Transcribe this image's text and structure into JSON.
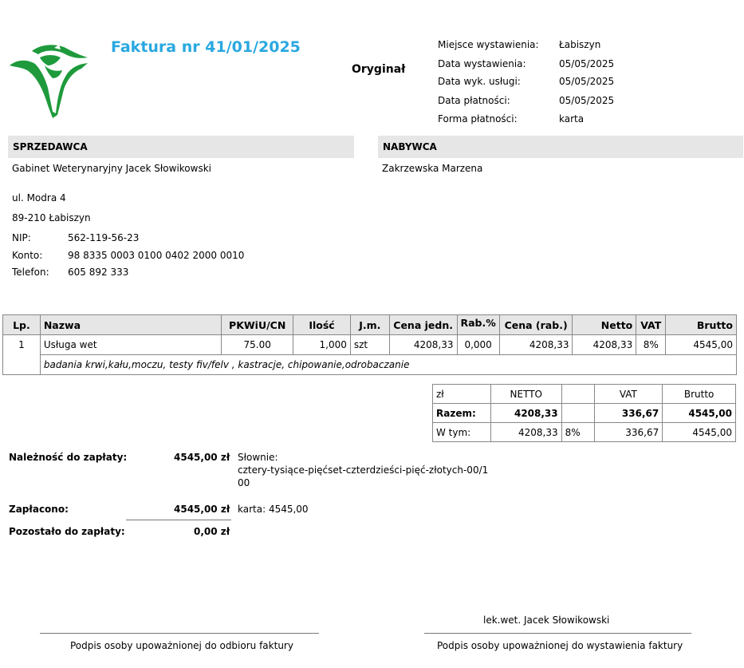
{
  "header": {
    "title": "Faktura nr 41/01/2025",
    "original": "Oryginał",
    "meta": [
      {
        "label": "Miejsce wystawienia:",
        "value": "Łabiszyn"
      },
      {
        "label": "Data wystawienia:",
        "value": "05/05/2025"
      },
      {
        "label": "Data wyk. usługi:",
        "value": "05/05/2025"
      },
      {
        "label": "Data płatności:",
        "value": "05/05/2025"
      },
      {
        "label": "Forma płatności:",
        "value": "karta"
      }
    ]
  },
  "seller": {
    "heading": "SPRZEDAWCA",
    "name": "Gabinet Weterynaryjny Jacek Słowikowski",
    "street": "ul. Modra 4",
    "city": "89-210 Łabiszyn",
    "nip_label": "NIP:",
    "nip": "562-119-56-23",
    "konto_label": "Konto:",
    "konto": "98 8335 0003 0100 0402 2000 0010",
    "tel_label": "Telefon:",
    "tel": "605 892 333"
  },
  "buyer": {
    "heading": "NABYWCA",
    "name": "Zakrzewska Marzena"
  },
  "items": {
    "headers": {
      "lp": "Lp.",
      "nazwa": "Nazwa",
      "pkwiu": "PKWiU/CN",
      "ilosc": "Ilość",
      "jm": "J.m.",
      "cena": "Cena jedn.",
      "rab": "Rab.%",
      "cena_rab": "Cena (rab.)",
      "netto": "Netto",
      "vat": "VAT",
      "brutto": "Brutto"
    },
    "row": {
      "lp": "1",
      "nazwa": "Usługa wet",
      "pkwiu": "75.00",
      "ilosc": "1,000",
      "jm": "szt",
      "cena": "4208,33",
      "rab": "0,000",
      "cena_rab": "4208,33",
      "netto": "4208,33",
      "vat": "8%",
      "brutto": "4545,00"
    },
    "description": "badania krwi,kału,moczu, testy fiv/felv , kastracje, chipowanie,odrobaczanie"
  },
  "totals": {
    "currency": "zł",
    "h_netto": "NETTO",
    "h_vat": "VAT",
    "h_brutto": "Brutto",
    "razem_label": "Razem:",
    "razem_netto": "4208,33",
    "razem_vat": "336,67",
    "razem_brutto": "4545,00",
    "wtym_label": "W tym:",
    "wtym_netto": "4208,33",
    "wtym_rate": "8%",
    "wtym_vat": "336,67",
    "wtym_brutto": "4545,00"
  },
  "payment": {
    "due_label": "Należność do zapłaty:",
    "due_value": "4545,00 zł",
    "words_label": "Słownie:",
    "words_line1": "cztery-tysiące-pięćset-czterdzieści-pięć-złotych-00/1",
    "words_line2": "00",
    "paid_label": "Zapłacono:",
    "paid_value": "4545,00 zł",
    "paid_method": "karta: 4545,00",
    "left_label": "Pozostało do zapłaty:",
    "left_value": "0,00 zł"
  },
  "signatures": {
    "issuer_name": "lek.wet. Jacek Słowikowski",
    "receiver_caption": "Podpis osoby upoważnionej do odbioru faktury",
    "issuer_caption": "Podpis osoby upoważnionej do wystawienia faktury"
  }
}
